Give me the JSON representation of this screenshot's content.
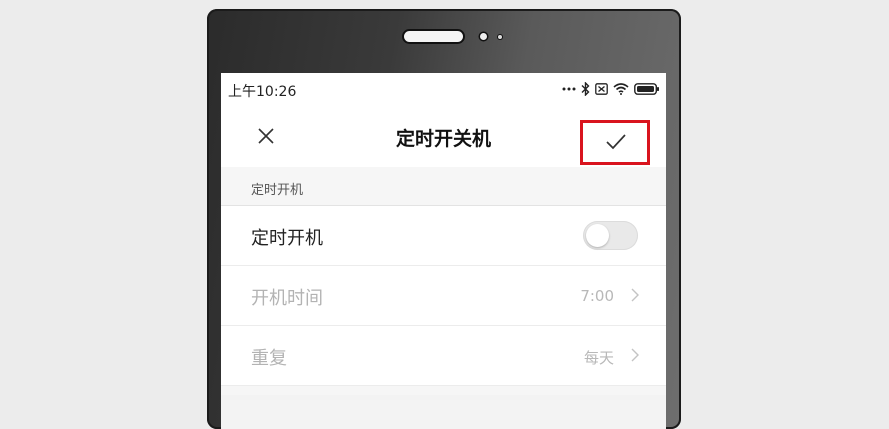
{
  "status_bar": {
    "time": "上午10:26",
    "icons": [
      "more-dots-icon",
      "bluetooth-icon",
      "no-sim-icon",
      "wifi-icon",
      "battery-icon"
    ]
  },
  "header": {
    "title": "定时开关机",
    "close_icon": "close-icon",
    "confirm_icon": "check-icon"
  },
  "section": {
    "title": "定时开机"
  },
  "rows": [
    {
      "label": "定时开机",
      "toggle_on": false
    },
    {
      "label": "开机时间",
      "value": "7:00",
      "disabled": true
    },
    {
      "label": "重复",
      "value": "每天",
      "disabled": true
    }
  ],
  "colors": {
    "highlight": "#d9141e",
    "toggle_off": "#e9e9e9"
  }
}
